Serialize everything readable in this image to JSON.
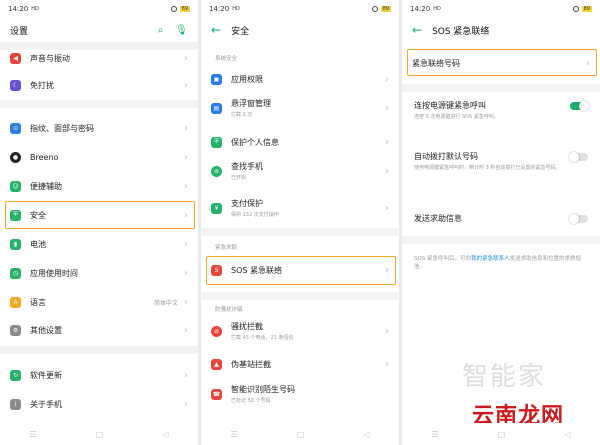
{
  "status": {
    "time": "14:20",
    "hd": "HD",
    "battery": "89"
  },
  "panel1": {
    "title": "设置",
    "items": [
      {
        "label": "声音与振动",
        "icon": "volume-icon",
        "color": "#e8463d"
      },
      {
        "label": "免打扰",
        "icon": "moon-icon",
        "color": "#6a4fd3"
      },
      {
        "label": "指纹、面部与密码",
        "icon": "fingerprint-icon",
        "color": "#2a7de1"
      },
      {
        "label": "Breeno",
        "icon": "breeno-icon",
        "color": "#222222"
      },
      {
        "label": "便捷辅助",
        "icon": "accessibility-icon",
        "color": "#24b36b"
      },
      {
        "label": "安全",
        "icon": "shield-icon",
        "color": "#24b36b"
      },
      {
        "label": "电池",
        "icon": "battery-icon",
        "color": "#24b36b"
      },
      {
        "label": "应用使用时间",
        "icon": "clock-icon",
        "color": "#24b36b"
      },
      {
        "label": "语言",
        "icon": "language-icon",
        "color": "#f5a623",
        "value": "简体中文"
      },
      {
        "label": "其他设置",
        "icon": "gear-icon",
        "color": "#8a8a8a"
      },
      {
        "label": "软件更新",
        "icon": "update-icon",
        "color": "#24b36b"
      },
      {
        "label": "关于手机",
        "icon": "info-icon",
        "color": "#8a8a8a"
      }
    ]
  },
  "panel2": {
    "title": "安全",
    "section1": "系统安全",
    "items1": [
      {
        "label": "应用权限",
        "sub": "",
        "icon": "app-permission-icon",
        "color": "#2a7de1"
      },
      {
        "label": "悬浮窗管理",
        "sub": "拦截 2 次",
        "icon": "floating-window-icon",
        "color": "#2a7de1"
      },
      {
        "label": "保护个人信息",
        "sub": "",
        "icon": "privacy-icon",
        "color": "#24b36b"
      },
      {
        "label": "查找手机",
        "sub": "已开启",
        "icon": "find-phone-icon",
        "color": "#24b36b"
      },
      {
        "label": "支付保护",
        "sub": "保护 132 次支付操作",
        "icon": "payment-protect-icon",
        "color": "#24b36b"
      }
    ],
    "section2": "紧急求助",
    "sos_label": "SOS 紧急联络",
    "section3": "防骚扰诈骗",
    "items3": [
      {
        "label": "骚扰拦截",
        "sub": "拦截 45 个电话，21 条短信",
        "icon": "block-icon",
        "color": "#e8463d"
      },
      {
        "label": "伪基站拦截",
        "sub": "",
        "icon": "fake-station-icon",
        "color": "#e8463d"
      },
      {
        "label": "智能识别陌生号码",
        "sub": "已标记 52 个号码",
        "icon": "caller-id-icon",
        "color": "#e8463d"
      }
    ]
  },
  "panel3": {
    "title": "SOS 紧急联络",
    "emergency_number": "紧急联络号码",
    "rows": [
      {
        "label": "连按电源键紧急呼叫",
        "sub": "连按 5 次电源键进行 SOS 紧急呼叫。",
        "on": true
      },
      {
        "label": "自动拨打默认号码",
        "sub": "使用电源键紧急呼叫时，倒计时 3 秒自动拨打已设置的紧急号码。",
        "on": false
      },
      {
        "label": "发送求助信息",
        "sub": "",
        "on": false
      }
    ],
    "note_before": "SOS 紧急呼叫后，可向",
    "note_link": "我的紧急联系人",
    "note_after": "发送求助信息和位置的求救短信。"
  },
  "watermark": {
    "top": "智能家",
    "bottom": "云南龙网"
  },
  "colors": {
    "accent": "#15b26b",
    "highlight": "#f5a623",
    "link": "#1a8fd6"
  }
}
